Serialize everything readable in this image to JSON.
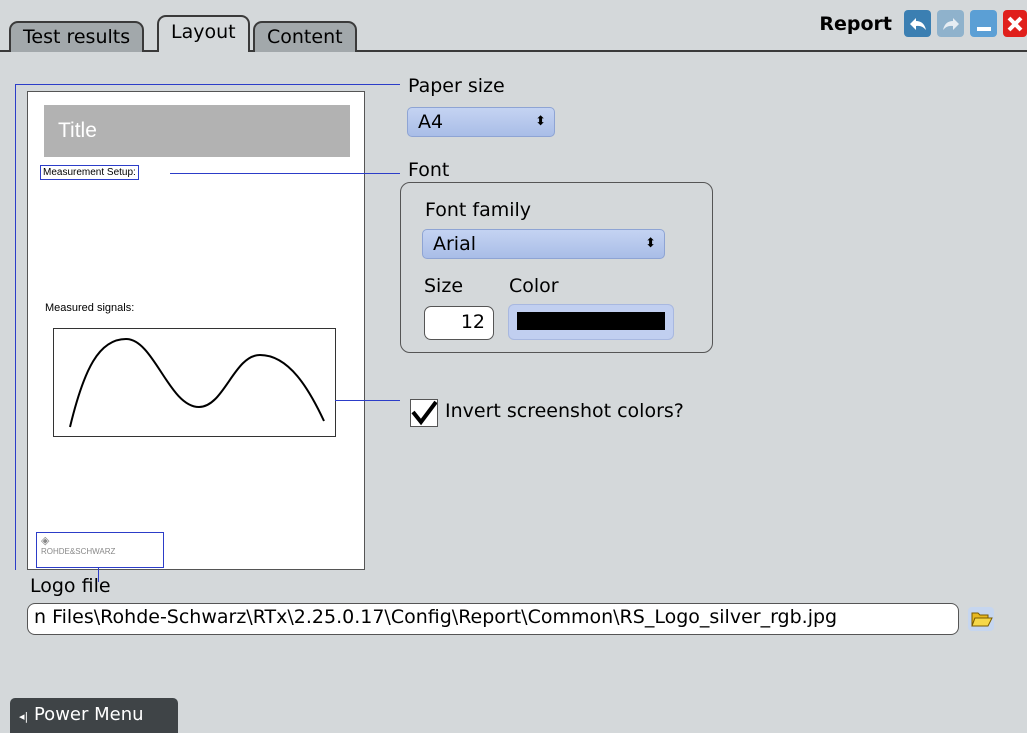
{
  "tabs": [
    {
      "label": "Test results",
      "active": false
    },
    {
      "label": "Layout",
      "active": true
    },
    {
      "label": "Content",
      "active": false
    }
  ],
  "window": {
    "title": "Report",
    "icons": [
      "undo-icon",
      "redo-icon",
      "minimize-icon",
      "close-icon"
    ]
  },
  "preview": {
    "title": "Title",
    "measurement_setup": "Measurement Setup:",
    "measured_signals": "Measured signals:",
    "logo_text": "ROHDE&SCHWARZ"
  },
  "paper_size": {
    "label": "Paper size",
    "value": "A4"
  },
  "font": {
    "label": "Font",
    "family_label": "Font family",
    "family_value": "Arial",
    "size_label": "Size",
    "size_value": "12",
    "color_label": "Color",
    "color_value": "#000000"
  },
  "invert": {
    "label": "Invert screenshot colors?",
    "checked": true
  },
  "logo_file": {
    "label": "Logo file",
    "value": "n Files\\Rohde-Schwarz\\RTx\\2.25.0.17\\Config\\Report\\Common\\RS_Logo_silver_rgb.jpg"
  },
  "power_menu": {
    "label": "Power Menu"
  },
  "colors": {
    "accent_blue": "#2c3dc8",
    "dropdown_bg": "#b4c6ec",
    "close_red": "#e0201c"
  }
}
